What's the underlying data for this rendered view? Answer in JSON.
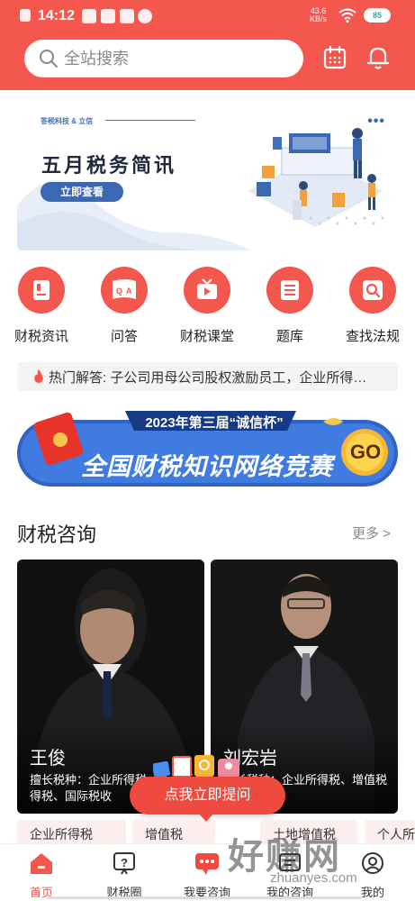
{
  "status_bar": {
    "time": "14:12",
    "net_speed": "43.6",
    "net_unit": "KB/s",
    "battery": "85"
  },
  "header": {
    "search_placeholder": "全站搜索",
    "calendar_icon": "calendar-icon",
    "bell_icon": "bell-icon"
  },
  "banner": {
    "brand": "答税科技 & 立信",
    "title": "五月税务简讯",
    "button": "立即查看"
  },
  "grid": [
    {
      "label": "财税资讯",
      "icon": "document-icon"
    },
    {
      "label": "问答",
      "icon": "qa-icon"
    },
    {
      "label": "财税课堂",
      "icon": "tv-icon"
    },
    {
      "label": "题库",
      "icon": "list-icon"
    },
    {
      "label": "查找法规",
      "icon": "search-doc-icon"
    }
  ],
  "hot": {
    "text": "热门解答: 子公司用母公司股权激励员工，企业所得…"
  },
  "contest": {
    "subtitle": "2023年第三届“诚信杯”",
    "title": "全国财税知识网络竞赛",
    "go": "GO"
  },
  "consult": {
    "title": "财税咨询",
    "more": "更多 >",
    "cards": [
      {
        "name": "王俊",
        "desc": "擅长税种：企业所得税、个人所得税、国际税收"
      },
      {
        "name": "刘宏岩",
        "desc": "擅长税种：企业所得税、增值税"
      }
    ],
    "tags": [
      "企业所得税",
      "增值税",
      "土地增值税",
      "个人所得"
    ]
  },
  "float": {
    "label": "点我立即提问"
  },
  "tabbar": [
    {
      "label": "首页",
      "active": true
    },
    {
      "label": "财税圈",
      "active": false
    },
    {
      "label": "我要咨询",
      "active": false
    },
    {
      "label": "我的咨询",
      "active": false
    },
    {
      "label": "我的",
      "active": false
    }
  ],
  "watermark": {
    "main": "好赚网",
    "sub": "zhuanyes.com"
  },
  "colors": {
    "brand": "#f3574d",
    "banner_blue": "#3a68b2"
  }
}
